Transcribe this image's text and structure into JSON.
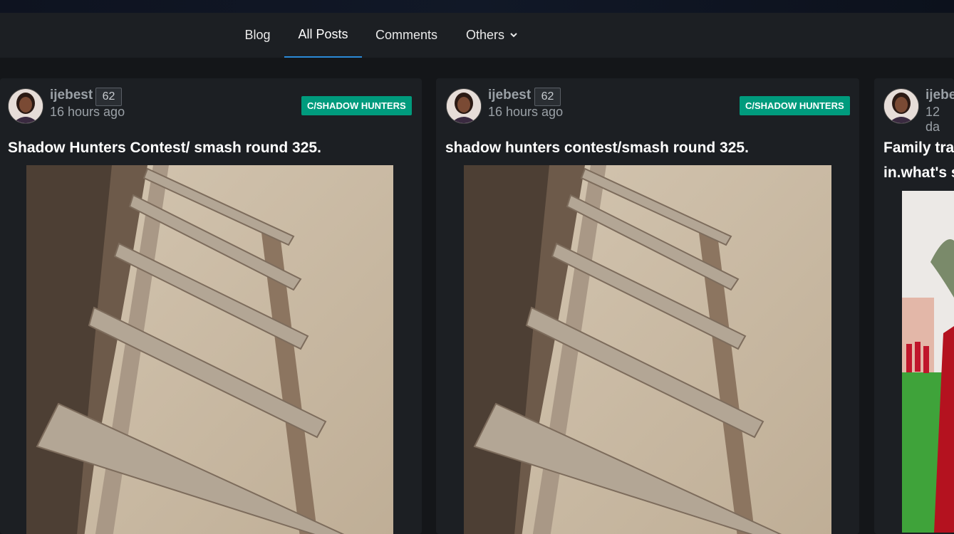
{
  "nav": {
    "items": [
      {
        "label": "Blog",
        "active": false
      },
      {
        "label": "All Posts",
        "active": true
      },
      {
        "label": "Comments",
        "active": false
      },
      {
        "label": "Others",
        "active": false,
        "dropdown": true
      }
    ]
  },
  "posts": [
    {
      "author": "ijebest",
      "reputation": "62",
      "time": "16 hours ago",
      "community": "C/SHADOW HUNTERS",
      "title": "Shadow Hunters Contest/ smash round 325.",
      "image": "wooden-ladder-in-trench"
    },
    {
      "author": "ijebest",
      "reputation": "62",
      "time": "16 hours ago",
      "community": "C/SHADOW HUNTERS",
      "title": "shadow hunters contest/smash round 325.",
      "image": "wooden-ladder-in-trench"
    },
    {
      "author": "ijebe",
      "time": "12 da",
      "title_line1": "Family tra",
      "title_line2": "in.what's s",
      "image": "family-outdoor-event"
    }
  ],
  "colors": {
    "accent": "#2b8ad8",
    "community_badge": "#009b7d",
    "card_bg": "#1c1f23",
    "page_bg": "#141619"
  }
}
